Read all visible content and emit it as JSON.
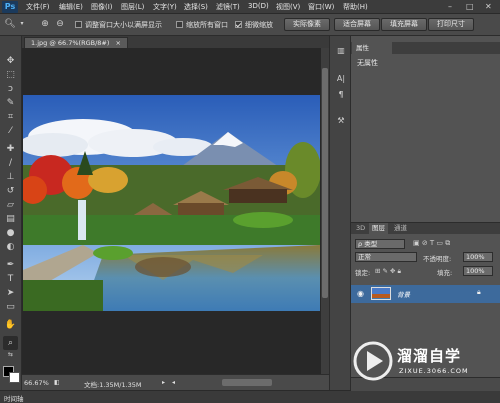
{
  "app": {
    "logo": "Ps"
  },
  "menubar": {
    "items": [
      "文件(F)",
      "编辑(E)",
      "图像(I)",
      "图层(L)",
      "文字(Y)",
      "选择(S)",
      "滤镜(T)",
      "3D(D)",
      "视图(V)",
      "窗口(W)",
      "帮助(H)"
    ],
    "window_controls": [
      "–",
      "□",
      "✕"
    ]
  },
  "options_bar": {
    "check_resize": {
      "label": "调整窗口大小以满屏显示",
      "checked": false
    },
    "check_zoom_all": {
      "label": "缩放所有窗口",
      "checked": false
    },
    "check_scrubby": {
      "label": "细微缩放",
      "checked": true
    },
    "btn_actual": "实际像素",
    "btn_fit": "适合屏幕",
    "btn_fill": "填充屏幕",
    "btn_print": "打印尺寸"
  },
  "document": {
    "tab_title": "1.jpg @ 66.7%(RGB/8#)",
    "tab_close": "×",
    "zoom": "66.67%",
    "doc_info": "文档:1.35M/1.35M"
  },
  "timeline": {
    "label": "时间轴"
  },
  "properties": {
    "tab": "属性",
    "body": "无属性"
  },
  "layers": {
    "tabs": [
      "3D",
      "图层",
      "通道"
    ],
    "filter_kind": "ρ 类型",
    "blend_mode": "正常",
    "opacity_label": "不透明度:",
    "opacity_value": "100%",
    "lock_label": "锁定:",
    "fill_label": "填充:",
    "fill_value": "100%",
    "layer_name": "背景"
  },
  "watermark": {
    "name": "溜溜自学",
    "url": "ZIXUE.3066.COM"
  },
  "colors": {
    "menubar_bg": "#3c3c3c",
    "panel_bg": "#535353",
    "canvas_bg": "#282828",
    "selected_layer": "#3d6a9c"
  }
}
